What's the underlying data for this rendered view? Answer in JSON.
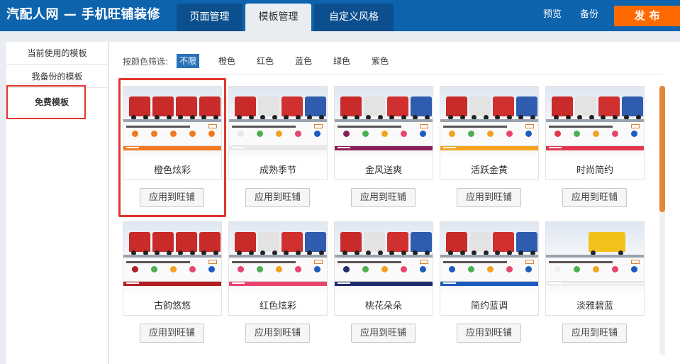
{
  "header": {
    "app_title": "汽配人网 — 手机旺铺装修",
    "tabs": [
      {
        "label": "页面管理",
        "active": false
      },
      {
        "label": "模板管理",
        "active": true
      },
      {
        "label": "自定义风格",
        "active": false
      }
    ],
    "preview_label": "预览",
    "backup_label": "备份",
    "publish_label": "发布"
  },
  "sidebar": {
    "items": [
      {
        "label": "当前使用的模板",
        "active": false
      },
      {
        "label": "我备份的模板",
        "active": false
      },
      {
        "label": "免费模板",
        "active": true
      }
    ]
  },
  "filter": {
    "label": "按颜色筛选:",
    "options": [
      {
        "label": "不限",
        "active": true
      },
      {
        "label": "橙色",
        "active": false
      },
      {
        "label": "红色",
        "active": false
      },
      {
        "label": "蓝色",
        "active": false
      },
      {
        "label": "绿色",
        "active": false
      },
      {
        "label": "紫色",
        "active": false
      }
    ]
  },
  "templates": [
    {
      "name": "橙色炫彩",
      "button": "应用到旺铺",
      "accent": "#f07a22",
      "selected": true
    },
    {
      "name": "成熟季节",
      "button": "应用到旺铺",
      "accent": "#e9e9e9",
      "selected": false
    },
    {
      "name": "金风送爽",
      "button": "应用到旺铺",
      "accent": "#8a1e5a",
      "selected": false
    },
    {
      "name": "活跃金黄",
      "button": "应用到旺铺",
      "accent": "#f4a21e",
      "selected": false
    },
    {
      "name": "时尚简约",
      "button": "应用到旺铺",
      "accent": "#e2354d",
      "selected": false
    },
    {
      "name": "古韵悠悠",
      "button": "应用到旺铺",
      "accent": "#b21e24",
      "selected": false
    },
    {
      "name": "红色炫彩",
      "button": "应用到旺铺",
      "accent": "#e8446e",
      "selected": false
    },
    {
      "name": "桃花朵朵",
      "button": "应用到旺铺",
      "accent": "#1f2c6e",
      "selected": false
    },
    {
      "name": "简约蓝调",
      "button": "应用到旺铺",
      "accent": "#1c5cc0",
      "selected": false
    },
    {
      "name": "淡雅碧蓝",
      "button": "应用到旺铺",
      "accent": "#f0f0f0",
      "selected": false
    }
  ],
  "colors": {
    "header_bg": "#0e63ad",
    "publish_bg": "#ff6a00",
    "filter_active_bg": "#2a72b8",
    "highlight_border": "#e0362e",
    "scroll_thumb": "#e58437"
  },
  "scroll": {
    "position_fraction": 0.0,
    "visible_fraction": 0.47
  }
}
